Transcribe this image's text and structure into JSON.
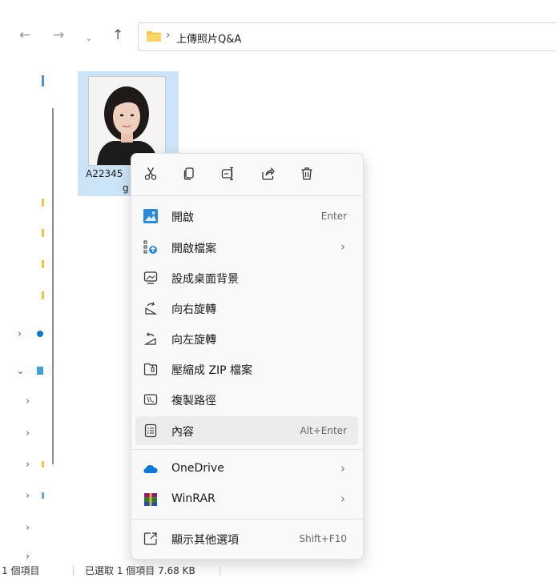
{
  "nav": {
    "back_icon": "arrow-left-icon",
    "forward_icon": "arrow-right-icon",
    "recent_icon": "chevron-down-icon",
    "up_icon": "arrow-up-icon",
    "breadcrumb_sep": "›",
    "folder_name": "上傳照片Q&A"
  },
  "file": {
    "name_line1": "A22345",
    "name_line2": "g"
  },
  "context_menu": {
    "quick_actions": [
      {
        "name": "cut",
        "icon": "scissors-icon"
      },
      {
        "name": "copy",
        "icon": "copy-icon"
      },
      {
        "name": "rename",
        "icon": "rename-icon"
      },
      {
        "name": "share",
        "icon": "share-icon"
      },
      {
        "name": "delete",
        "icon": "trash-icon"
      }
    ],
    "items": [
      {
        "label": "開啟",
        "shortcut": "Enter",
        "icon": "photos-app-icon"
      },
      {
        "label": "開啟檔案",
        "arrow": "›",
        "icon": "open-with-icon"
      },
      {
        "label": "設成桌面背景",
        "icon": "desktop-background-icon"
      },
      {
        "label": "向右旋轉",
        "icon": "rotate-right-icon"
      },
      {
        "label": "向左旋轉",
        "icon": "rotate-left-icon"
      },
      {
        "label": "壓縮成 ZIP 檔案",
        "icon": "zip-folder-icon"
      },
      {
        "label": "複製路徑",
        "icon": "copy-path-icon"
      },
      {
        "label": "內容",
        "shortcut": "Alt+Enter",
        "icon": "properties-icon"
      },
      {
        "label": "OneDrive",
        "arrow": "›",
        "icon": "onedrive-cloud-icon"
      },
      {
        "label": "WinRAR",
        "arrow": "›",
        "icon": "winrar-icon"
      },
      {
        "label": "顯示其他選項",
        "shortcut": "Shift+F10",
        "icon": "more-options-icon"
      }
    ]
  },
  "status_bar": {
    "item_count": "1 個項目",
    "selected": "已選取 1 個項目  7.68 KB"
  },
  "colors": {
    "selection": "#cce4f7",
    "menu_bg": "#f9f9f9",
    "folder_yellow": "#f3c443",
    "onedrive_blue": "#0a78d4"
  }
}
